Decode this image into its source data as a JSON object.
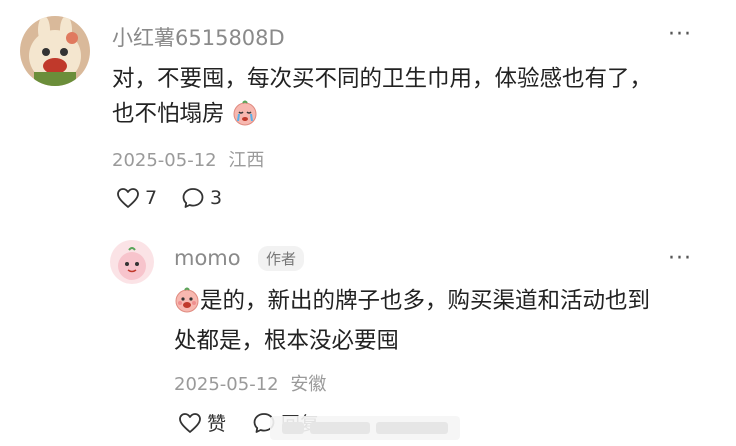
{
  "comment1": {
    "username": "小红薯6515808D",
    "text_line1": "对，不要囤，每次买不同的卫生巾用，体验感也有了，",
    "text_line2": "也不怕塌房",
    "date": "2025-05-12",
    "location": "江西",
    "likes": "7",
    "replies": "3",
    "more_label": "···"
  },
  "reply1": {
    "username": "momo",
    "badge": "作者",
    "text_line1": "是的，新出的牌子也多，购买渠道和活动也到",
    "text_line2": "处都是，根本没必要囤",
    "date": "2025-05-12",
    "location": "安徽",
    "like_label": "赞",
    "reply_label": "回复",
    "more_label": "···"
  }
}
